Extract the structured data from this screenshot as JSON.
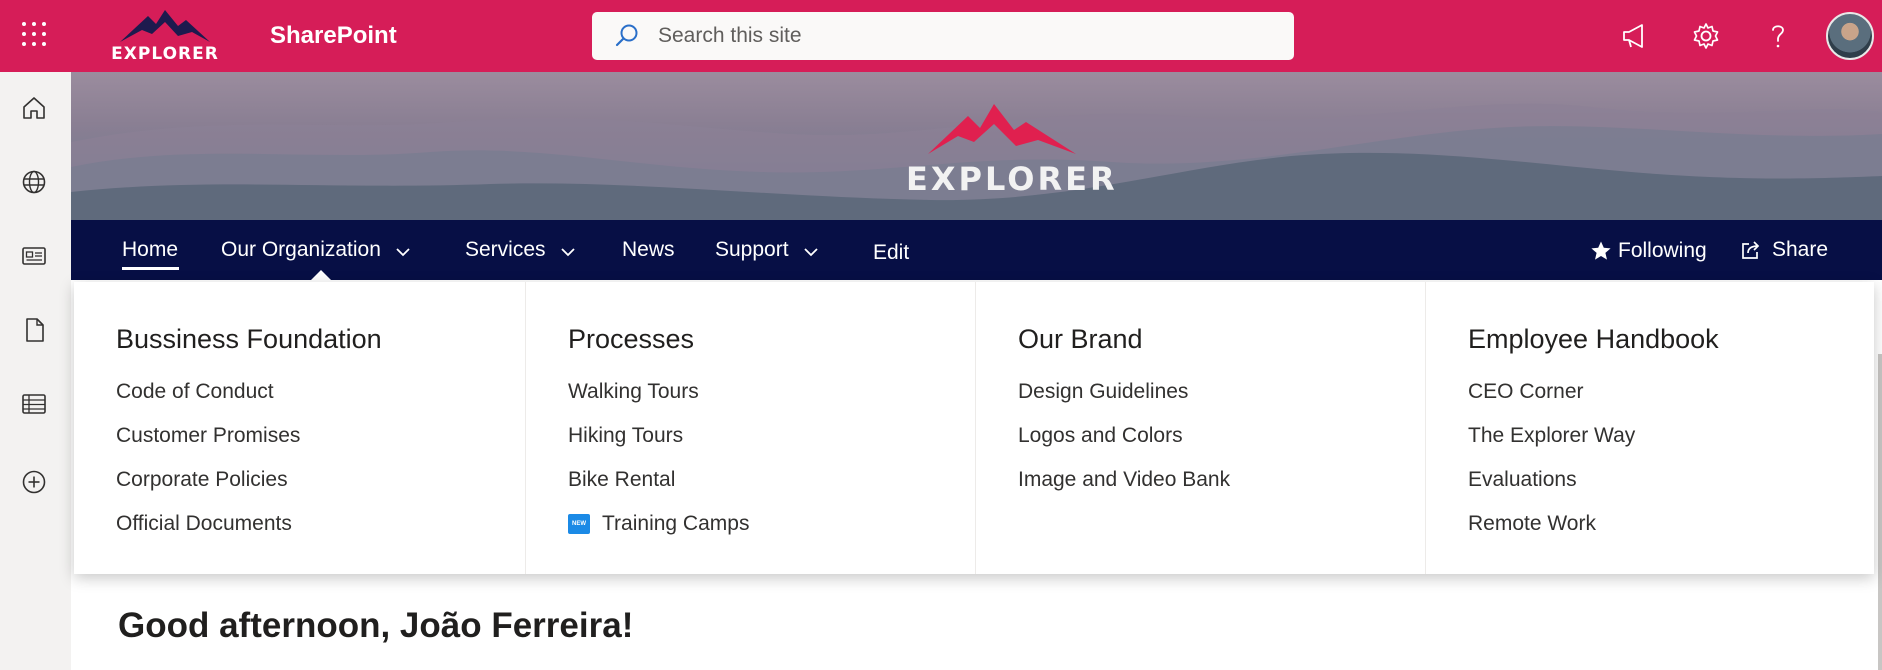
{
  "suite_bar": {
    "app_name": "SharePoint",
    "logo_text": "EXPLORER",
    "search_placeholder": "Search this site",
    "accent_color": "#d61d58",
    "icons": [
      "app-launcher-icon",
      "megaphone-icon",
      "gear-icon",
      "help-icon",
      "avatar"
    ]
  },
  "left_rail": {
    "icons": [
      "home-icon",
      "globe-icon",
      "news-icon",
      "file-icon",
      "list-icon",
      "add-icon"
    ]
  },
  "hero": {
    "logo_text": "EXPLORER"
  },
  "nav": {
    "background_color": "#070f45",
    "items": [
      {
        "label": "Home",
        "selected": true
      },
      {
        "label": "Our Organization",
        "has_dropdown": true
      },
      {
        "label": "Services",
        "has_dropdown": true
      },
      {
        "label": "News"
      },
      {
        "label": "Support",
        "has_dropdown": true
      },
      {
        "label": "Edit"
      }
    ],
    "following_label": "Following",
    "share_label": "Share"
  },
  "megamenu": {
    "columns": [
      {
        "heading": "Bussiness Foundation",
        "links": [
          "Code of Conduct",
          "Customer Promises",
          "Corporate Policies",
          "Official Documents"
        ]
      },
      {
        "heading": "Processes",
        "links": [
          "Walking Tours",
          "Hiking Tours",
          "Bike Rental",
          "Training Camps"
        ],
        "new_badge_on": "Training Camps",
        "new_badge_text": "NEW"
      },
      {
        "heading": "Our Brand",
        "links": [
          "Design Guidelines",
          "Logos and Colors",
          "Image and Video Bank"
        ]
      },
      {
        "heading": "Employee Handbook",
        "links": [
          "CEO Corner",
          "The Explorer Way",
          "Evaluations",
          "Remote Work"
        ]
      }
    ]
  },
  "page": {
    "greeting": "Good afternoon, João Ferreira!"
  }
}
